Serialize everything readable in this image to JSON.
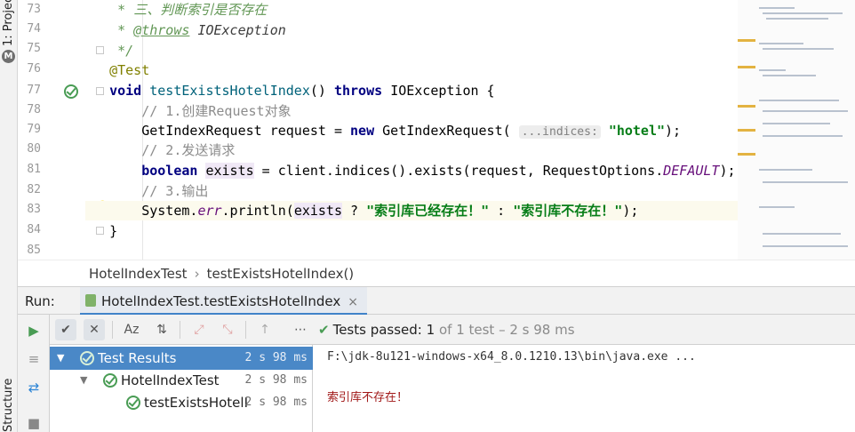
{
  "side_tabs": {
    "project": "1: Project",
    "structure": "Structure"
  },
  "editor": {
    "line_numbers": [
      "73",
      "74",
      "75",
      "76",
      "77",
      "78",
      "79",
      "80",
      "81",
      "82",
      "83",
      "84",
      "85"
    ],
    "lines": {
      "l73": "三、判断索引是否存在",
      "l74_tag": "@throws",
      "l74_ref": "IOException",
      "l76": "@Test",
      "l77_kw1": "void",
      "l77_fn": "testExistsHotelIndex",
      "l77_kw2": "throws",
      "l77_rest": "IOException {",
      "l78": "// 1.创建Request对象",
      "l79_a": "GetIndexRequest request = ",
      "l79_new": "new",
      "l79_b": " GetIndexRequest(",
      "l79_hint": "...indices:",
      "l79_str": "\"hotel\"",
      "l79_c": ");",
      "l80": "// 2.发送请求",
      "l81_kw": "boolean",
      "l81_var": "exists",
      "l81_a": " = client.indices().exists(request, RequestOptions.",
      "l81_field": "DEFAULT",
      "l81_b": ");",
      "l82": "// 3.输出",
      "l83_a": "System.",
      "l83_field": "err",
      "l83_b": ".println(",
      "l83_var": "exists",
      "l83_c": " ? ",
      "l83_str1": "\"索引库已经存在！\"",
      "l83_d": " : ",
      "l83_str2": "\"索引库不存在！\"",
      "l83_e": ");",
      "l84": "}"
    }
  },
  "breadcrumb": {
    "class": "HotelIndexTest",
    "method": "testExistsHotelIndex()"
  },
  "run": {
    "label": "Run:",
    "tab_label": "HotelIndexTest.testExistsHotelIndex",
    "tab_close": "×"
  },
  "status": {
    "passed_label": "Tests passed:",
    "passed_count": "1",
    "of_text": "of 1 test",
    "duration": "– 2 s 98 ms"
  },
  "tree": [
    {
      "name": "Test Results",
      "time": "2 s 98 ms"
    },
    {
      "name": "HotelIndexTest",
      "time": "2 s 98 ms"
    },
    {
      "name": "testExistsHotelIndex",
      "time": "2 s 98 ms"
    }
  ],
  "console": {
    "command": "F:\\jdk-8u121-windows-x64_8.0.1210.13\\bin\\java.exe ...",
    "output": "索引库不存在！"
  },
  "colors": {
    "accent": "#4a88c7",
    "success": "#499c54",
    "error_text": "#a11818"
  },
  "icons": [
    "run-icon",
    "check-icon",
    "lightbulb-icon",
    "sort-alpha-icon",
    "sort-duration-icon",
    "expand-icon",
    "collapse-icon",
    "up-icon",
    "more-icon"
  ]
}
